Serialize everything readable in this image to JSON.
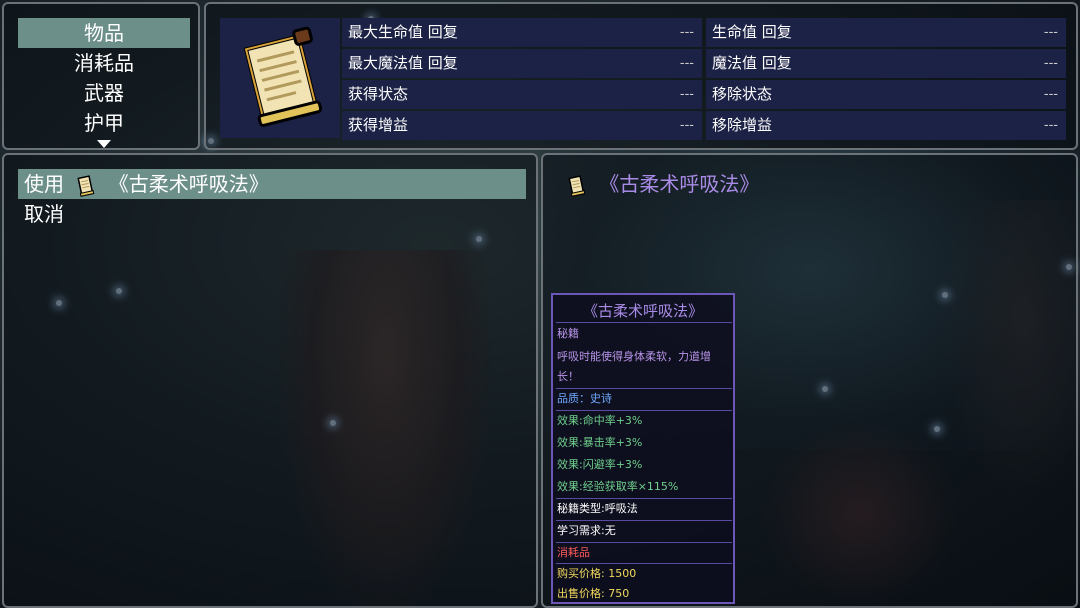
{
  "categories": {
    "items": [
      "物品",
      "消耗品",
      "武器",
      "护甲"
    ],
    "selected_index": 0
  },
  "effects": {
    "left": [
      {
        "label": "最大生命值 回复",
        "value": "---"
      },
      {
        "label": "最大魔法值 回复",
        "value": "---"
      },
      {
        "label": "获得状态",
        "value": "---"
      },
      {
        "label": "获得增益",
        "value": "---"
      }
    ],
    "right": [
      {
        "label": "生命值 回复",
        "value": "---"
      },
      {
        "label": "魔法值 回复",
        "value": "---"
      },
      {
        "label": "移除状态",
        "value": "---"
      },
      {
        "label": "移除增益",
        "value": "---"
      }
    ]
  },
  "actions": {
    "use_label": "使用",
    "use_item_name": "《古柔术呼吸法》",
    "cancel_label": "取消"
  },
  "description": {
    "item_name": "《古柔术呼吸法》"
  },
  "tooltip": {
    "title": "《古柔术呼吸法》",
    "type": "秘籍",
    "description": "呼吸时能使得身体柔软，力道增长！",
    "quality": "品质：史诗",
    "effects": [
      "效果:命中率+3%",
      "效果:暴击率+3%",
      "效果:闪避率+3%",
      "效果:经验获取率×115%"
    ],
    "book_type": "秘籍类型:呼吸法",
    "requirement": "学习需求:无",
    "category": "消耗品",
    "buy_price": "购买价格: 1500",
    "sell_price": "出售价格: 750"
  },
  "colors": {
    "selected_row": "#6d8f8a",
    "effect_cell": "#1c2246",
    "tooltip_border": "#6c57b8",
    "purple_text": "#a98be6",
    "blue_text": "#6fa8ff",
    "green_text": "#6fd08c",
    "red_text": "#ff5a5a",
    "yellow_text": "#f2d95c"
  }
}
